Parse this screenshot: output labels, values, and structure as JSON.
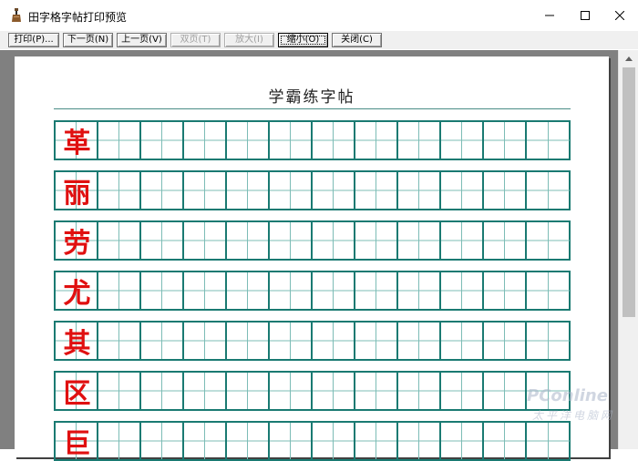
{
  "window": {
    "title": "田字格字帖打印预览",
    "icon": "app-icon",
    "controls": [
      "minimize-icon",
      "maximize-icon",
      "close-icon"
    ]
  },
  "toolbar": {
    "buttons": [
      {
        "label": "打印(P)...",
        "enabled": true
      },
      {
        "label": "下一页(N)",
        "enabled": true
      },
      {
        "label": "上一页(V)",
        "enabled": true
      },
      {
        "label": "双页(T)",
        "enabled": false
      },
      {
        "label": "放大(I)",
        "enabled": false
      },
      {
        "label": "缩小(O)",
        "enabled": true,
        "default": true
      },
      {
        "label": "关闭(C)",
        "enabled": true
      }
    ]
  },
  "document": {
    "title": "学霸练字帖",
    "characters": [
      "革",
      "丽",
      "劳",
      "尤",
      "其",
      "区",
      "巨"
    ],
    "columns_per_row": 12
  },
  "watermark": {
    "line1": "PConline",
    "line2": "太平洋电脑网"
  },
  "colors": {
    "grid": "#1a7a72",
    "character": "#e01010",
    "viewport": "#808080"
  }
}
